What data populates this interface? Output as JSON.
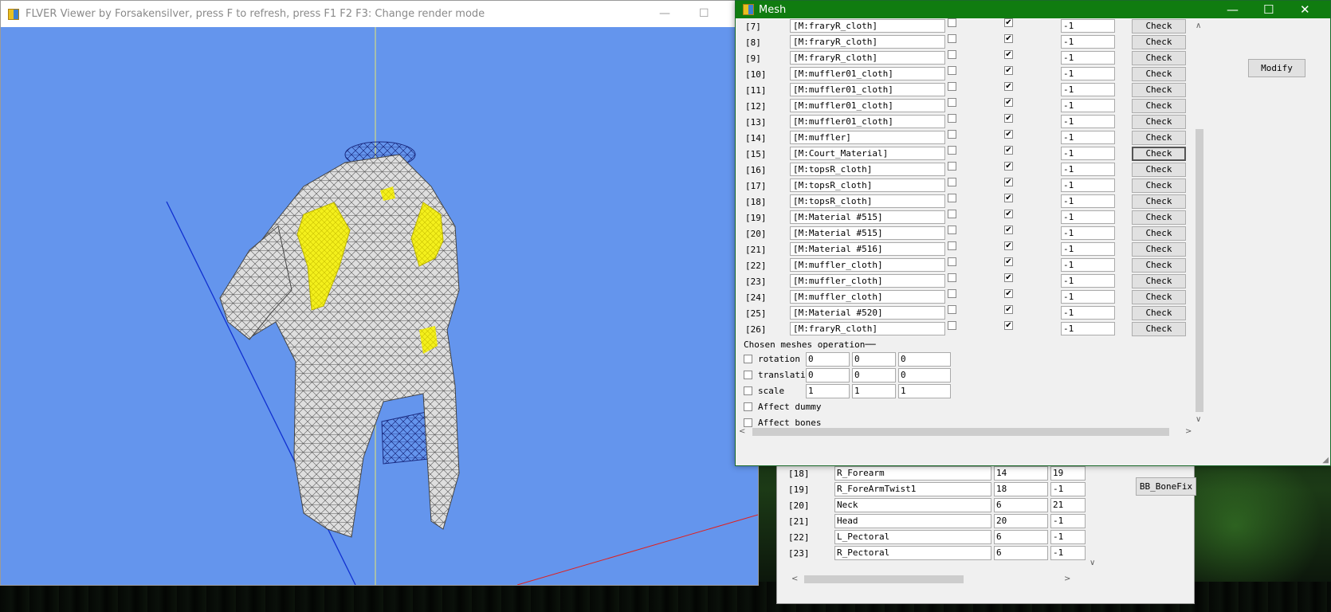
{
  "viewer": {
    "title": "FLVER Viewer by Forsakensilver, press F to refresh, press F1 F2 F3: Change render mode",
    "minimize": "—",
    "maximize": "☐",
    "colors": {
      "background": "#6495ed",
      "axis_x": "#e0201e",
      "axis_y": "#e8e870",
      "axis_z": "#1030d0",
      "highlight": "#f0f020"
    }
  },
  "mesh_window": {
    "title": "Mesh",
    "minimize": "—",
    "maximize": "☐",
    "close": "✕",
    "rows": [
      {
        "index": "[7]",
        "name": "[M:fraryR_cloth]",
        "checked1": false,
        "checked2": true,
        "value": "-1",
        "button": "Check"
      },
      {
        "index": "[8]",
        "name": "[M:fraryR_cloth]",
        "checked1": false,
        "checked2": true,
        "value": "-1",
        "button": "Check"
      },
      {
        "index": "[9]",
        "name": "[M:fraryR_cloth]",
        "checked1": false,
        "checked2": true,
        "value": "-1",
        "button": "Check"
      },
      {
        "index": "[10]",
        "name": "[M:muffler01_cloth]",
        "checked1": false,
        "checked2": true,
        "value": "-1",
        "button": "Check"
      },
      {
        "index": "[11]",
        "name": "[M:muffler01_cloth]",
        "checked1": false,
        "checked2": true,
        "value": "-1",
        "button": "Check"
      },
      {
        "index": "[12]",
        "name": "[M:muffler01_cloth]",
        "checked1": false,
        "checked2": true,
        "value": "-1",
        "button": "Check"
      },
      {
        "index": "[13]",
        "name": "[M:muffler01_cloth]",
        "checked1": false,
        "checked2": true,
        "value": "-1",
        "button": "Check"
      },
      {
        "index": "[14]",
        "name": "[M:muffler]",
        "checked1": false,
        "checked2": true,
        "value": "-1",
        "button": "Check"
      },
      {
        "index": "[15]",
        "name": "[M:Court_Material]",
        "checked1": false,
        "checked2": true,
        "value": "-1",
        "button": "Check",
        "selected": true
      },
      {
        "index": "[16]",
        "name": "[M:topsR_cloth]",
        "checked1": false,
        "checked2": true,
        "value": "-1",
        "button": "Check"
      },
      {
        "index": "[17]",
        "name": "[M:topsR_cloth]",
        "checked1": false,
        "checked2": true,
        "value": "-1",
        "button": "Check"
      },
      {
        "index": "[18]",
        "name": "[M:topsR_cloth]",
        "checked1": false,
        "checked2": true,
        "value": "-1",
        "button": "Check"
      },
      {
        "index": "[19]",
        "name": "[M:Material #515]",
        "checked1": false,
        "checked2": true,
        "value": "-1",
        "button": "Check"
      },
      {
        "index": "[20]",
        "name": "[M:Material #515]",
        "checked1": false,
        "checked2": true,
        "value": "-1",
        "button": "Check"
      },
      {
        "index": "[21]",
        "name": "[M:Material #516]",
        "checked1": false,
        "checked2": true,
        "value": "-1",
        "button": "Check"
      },
      {
        "index": "[22]",
        "name": "[M:muffler_cloth]",
        "checked1": false,
        "checked2": true,
        "value": "-1",
        "button": "Check"
      },
      {
        "index": "[23]",
        "name": "[M:muffler_cloth]",
        "checked1": false,
        "checked2": true,
        "value": "-1",
        "button": "Check"
      },
      {
        "index": "[24]",
        "name": "[M:muffler_cloth]",
        "checked1": false,
        "checked2": true,
        "value": "-1",
        "button": "Check"
      },
      {
        "index": "[25]",
        "name": "[M:Material #520]",
        "checked1": false,
        "checked2": true,
        "value": "-1",
        "button": "Check"
      },
      {
        "index": "[26]",
        "name": "[M:fraryR_cloth]",
        "checked1": false,
        "checked2": true,
        "value": "-1",
        "button": "Check"
      }
    ],
    "operations": {
      "title": "Chosen meshes operation",
      "rotation": {
        "label": "rotation",
        "values": [
          "0",
          "0",
          "0"
        ]
      },
      "translation": {
        "label": "translati",
        "values": [
          "0",
          "0",
          "0"
        ]
      },
      "scale": {
        "label": "scale",
        "values": [
          "1",
          "1",
          "1"
        ]
      },
      "affect_dummy": "Affect dummy",
      "affect_bones": "Affect bones"
    },
    "modify_button": "Modify"
  },
  "bone_window": {
    "rows": [
      {
        "index": "[18]",
        "name": "R_Forearm",
        "parent": "14",
        "child": "19"
      },
      {
        "index": "[19]",
        "name": "R_ForeArmTwist1",
        "parent": "18",
        "child": "-1"
      },
      {
        "index": "[20]",
        "name": "Neck",
        "parent": "6",
        "child": "21"
      },
      {
        "index": "[21]",
        "name": "Head",
        "parent": "20",
        "child": "-1"
      },
      {
        "index": "[22]",
        "name": "L_Pectoral",
        "parent": "6",
        "child": "-1"
      },
      {
        "index": "[23]",
        "name": "R_Pectoral",
        "parent": "6",
        "child": "-1"
      }
    ],
    "bb_bonefix_button": "BB_BoneFix"
  }
}
